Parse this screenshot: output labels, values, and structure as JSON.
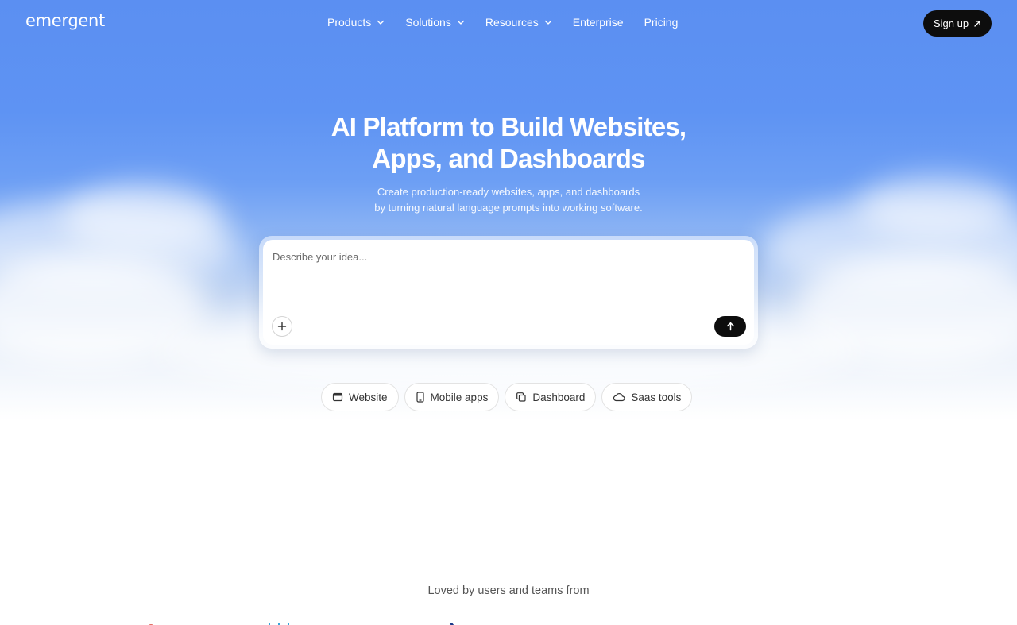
{
  "header": {
    "logo": "emergent",
    "nav": [
      {
        "label": "Products",
        "has_dropdown": true
      },
      {
        "label": "Solutions",
        "has_dropdown": true
      },
      {
        "label": "Resources",
        "has_dropdown": true
      },
      {
        "label": "Enterprise",
        "has_dropdown": false
      },
      {
        "label": "Pricing",
        "has_dropdown": false
      }
    ],
    "signup_label": "Sign up",
    "signup_icon": "arrow-up-right-icon"
  },
  "hero": {
    "headline_line1": "AI Platform to Build Websites,",
    "headline_line2": "Apps, and Dashboards",
    "subtext_line1": "Create production-ready websites, apps, and dashboards",
    "subtext_line2": "by turning natural language prompts into working software."
  },
  "prompt": {
    "placeholder": "Describe your idea...",
    "value": "",
    "attach_icon": "plus-icon",
    "send_icon": "arrow-up-icon"
  },
  "chips": [
    {
      "label": "Website",
      "icon": "browser-window-icon"
    },
    {
      "label": "Mobile apps",
      "icon": "mobile-phone-icon"
    },
    {
      "label": "Dashboard",
      "icon": "copy-pages-icon"
    },
    {
      "label": "Saas tools",
      "icon": "cloud-icon"
    }
  ],
  "social_proof": {
    "label": "Loved by users and teams from"
  },
  "colors": {
    "sky_top": "#5b8ff2",
    "button_dark": "#0d0d0d",
    "text_white": "#ffffff"
  }
}
